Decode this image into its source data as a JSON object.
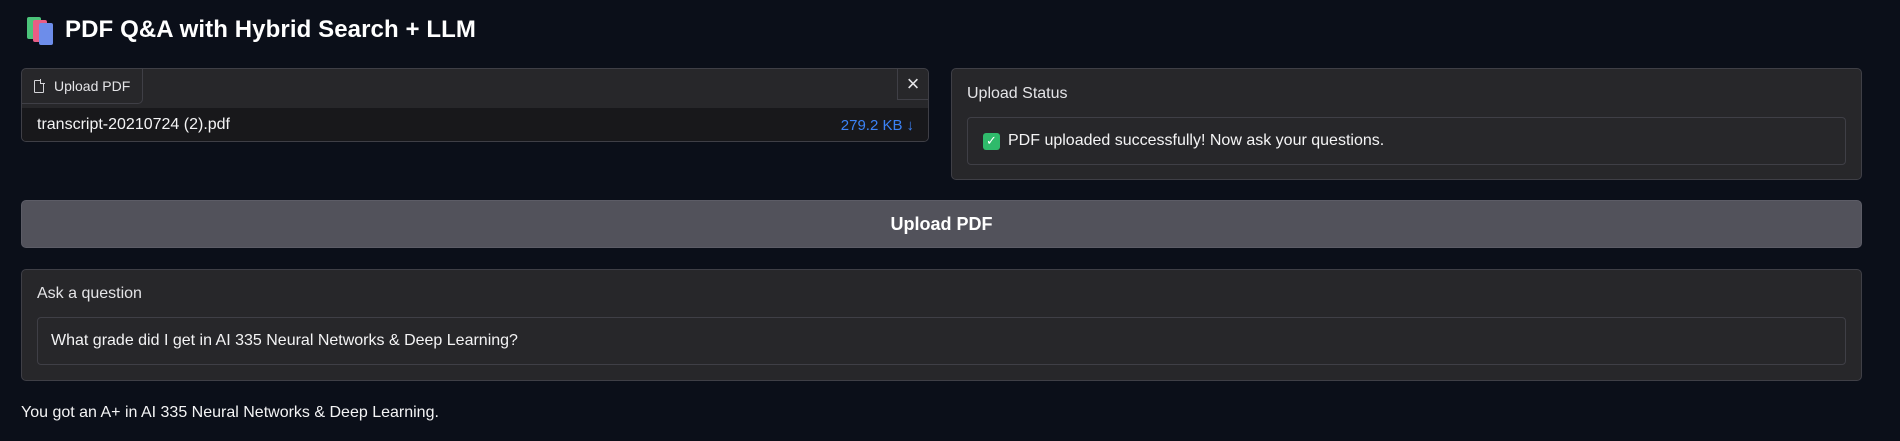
{
  "header": {
    "title": "PDF Q&A with Hybrid Search + LLM",
    "icon": "books-icon"
  },
  "file_upload": {
    "tab_label": "Upload PDF",
    "file_name": "transcript-20210724 (2).pdf",
    "file_size": "279.2 KB",
    "download_glyph": "↓",
    "close_glyph": "×"
  },
  "status": {
    "label": "Upload Status",
    "message": "PDF uploaded successfully! Now ask your questions.",
    "icon": "check-mark-icon"
  },
  "upload_button": {
    "label": "Upload PDF"
  },
  "question": {
    "label": "Ask a question",
    "value": "What grade did I get in AI 335 Neural Networks & Deep Learning?"
  },
  "answer": {
    "text": "You got an A+ in AI 335 Neural Networks & Deep Learning."
  },
  "colors": {
    "background": "#0b0f19",
    "panel": "#27272a",
    "button": "#52525b",
    "accent_link": "#3b82f6",
    "check": "#2fba6b"
  }
}
